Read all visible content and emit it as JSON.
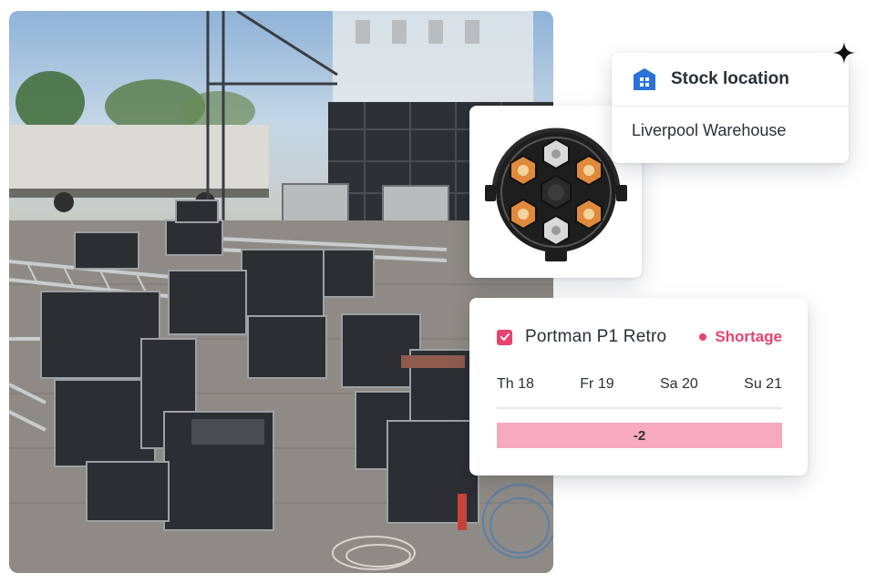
{
  "stock_location": {
    "title": "Stock location",
    "value": "Liverpool Warehouse",
    "icon": "warehouse-icon",
    "icon_color": "#2a72d8"
  },
  "product": {
    "image": "stage-light-fixture",
    "name": "Portman P1 Retro",
    "selected": true,
    "status": "Shortage",
    "status_color": "#e8426e"
  },
  "availability": {
    "days": [
      "Th 18",
      "Fr 19",
      "Sa 20",
      "Su 21"
    ],
    "bar_value": "-2",
    "bar_color": "#f7a9bd"
  },
  "background": {
    "scene": "outdoor stage build with flight cases and truss"
  }
}
